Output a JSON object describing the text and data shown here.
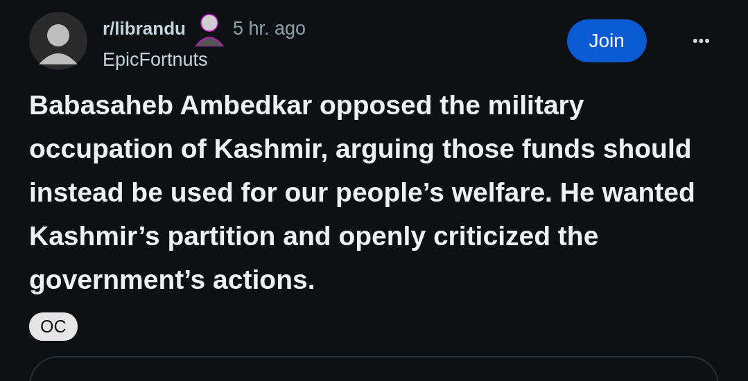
{
  "post": {
    "subreddit": "r/librandu",
    "time": "5 hr. ago",
    "author": "EpicFortnuts",
    "join_button": "Join",
    "more_button": "•••",
    "title": "Babasaheb Ambedkar opposed the military occupation of Kashmir, arguing those funds should instead be used for our people’s welfare. He wanted Kashmir’s partition and openly criticized the government’s actions.",
    "flair": "OC"
  }
}
